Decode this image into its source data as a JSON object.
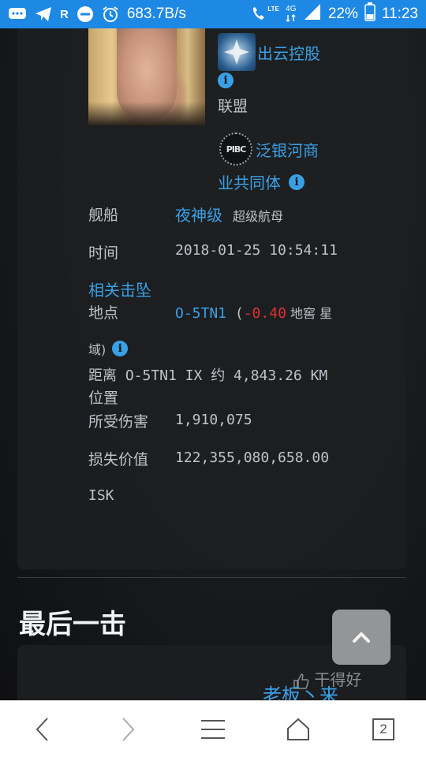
{
  "statusbar": {
    "net_speed": "683.7B/s",
    "signal_type": "4G",
    "lte": "LTE",
    "battery": "22%",
    "time": "11:23",
    "r_label": "R"
  },
  "killmail": {
    "corp_name": "出云控股",
    "alliance_prefix": "联盟",
    "alliance_name_line1": "泛银河商",
    "alliance_name_line2": "业共同体",
    "alliance_logo_text": "PIBC",
    "ship_label": "舰船",
    "ship_name": "夜神级",
    "ship_class": "超级航母",
    "time_label": "时间",
    "time_value": "2018-01-25 10:54:11",
    "related_kills": "相关击坠",
    "location_label": "地点",
    "system_name": "O-5TN1",
    "paren_open": " (",
    "security": "-0.40",
    "region_part1": " 地窖 星",
    "region_part2": "域)",
    "distance_text": "距离 O-5TN1 IX 约 4,843.26 KM",
    "position_label": "位置",
    "damage_label": "所受伤害",
    "damage_value": "1,910,075",
    "loss_label": "损失价值",
    "loss_value": "122,355,080,658.00",
    "isk": "ISK"
  },
  "final_blow": {
    "title": "最后一击"
  },
  "watermark": {
    "line1": "干得好",
    "line2": "老板丶来"
  },
  "bottomnav": {
    "tab_count": "2"
  },
  "colors": {
    "statusbar": "#1e88e5",
    "link": "#3aa0e6",
    "security": "#e03030"
  }
}
